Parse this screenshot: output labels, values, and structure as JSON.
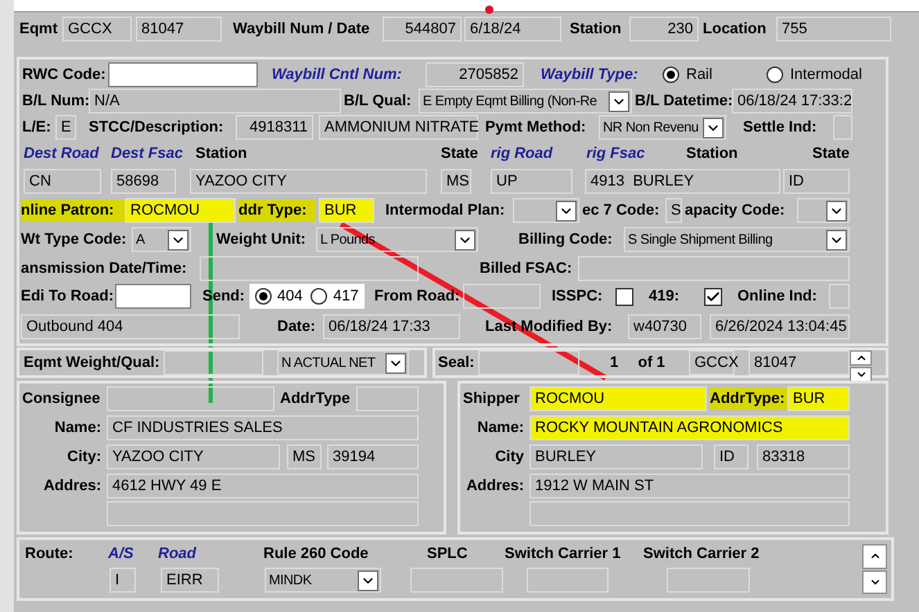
{
  "header": [
    {
      "kind": "label",
      "text": "Eqmt"
    },
    {
      "kind": "field",
      "value": "GCCX"
    },
    {
      "kind": "field",
      "value": "81047"
    },
    {
      "kind": "label",
      "text": "Waybill Num / Date"
    },
    {
      "kind": "field",
      "value": "544807"
    },
    {
      "kind": "field",
      "value": "6/18/24"
    },
    {
      "kind": "label",
      "text": "Station"
    },
    {
      "kind": "field",
      "value": "230"
    },
    {
      "kind": "label",
      "text": "Location"
    },
    {
      "kind": "field",
      "value": "755"
    }
  ],
  "waybill": [
    [
      {
        "kind": "label",
        "text": "RWC Code:"
      },
      {
        "kind": "input"
      },
      {
        "kind": "heading",
        "text": "Waybill Cntl Num:"
      },
      {
        "kind": "field",
        "value": "2705852"
      },
      {
        "kind": "heading",
        "text": "Waybill Type:"
      },
      {
        "kind": "radio",
        "label": "Rail",
        "selected": true
      },
      {
        "kind": "radio",
        "label": "Intermodal",
        "selected": false
      }
    ],
    [
      {
        "kind": "label",
        "text": "B/L Num:"
      },
      {
        "kind": "field",
        "value": "N/A"
      },
      {
        "kind": "label",
        "text": "B/L Qual:"
      },
      {
        "kind": "select",
        "value": "E Empty Eqmt Billing (Non-Re"
      },
      {
        "kind": "label",
        "text": "B/L Datetime:"
      },
      {
        "kind": "field",
        "value": "06/18/24 17:33:2"
      }
    ],
    [
      {
        "kind": "label",
        "text": "L/E:"
      },
      {
        "kind": "field",
        "value": "E"
      },
      {
        "kind": "label",
        "text": "STCC/Description:"
      },
      {
        "kind": "field",
        "value": "4918311"
      },
      {
        "kind": "field",
        "value": "AMMONIUM NITRATE"
      },
      {
        "kind": "label",
        "text": "Pymt Method:"
      },
      {
        "kind": "select",
        "value": "NR Non Revenu"
      },
      {
        "kind": "label",
        "text": "Settle Ind:"
      },
      {
        "kind": "field"
      }
    ],
    [
      {
        "kind": "heading",
        "text": "Dest Road"
      },
      {
        "kind": "heading",
        "text": "Dest Fsac"
      },
      {
        "kind": "label",
        "text": "Station"
      },
      {
        "kind": "label",
        "text": "State"
      },
      {
        "kind": "heading",
        "text": "rig Road"
      },
      {
        "kind": "heading",
        "text": "rig Fsac"
      },
      {
        "kind": "label",
        "text": "Station"
      },
      {
        "kind": "label",
        "text": "State"
      }
    ],
    [
      {
        "kind": "field",
        "value": "CN"
      },
      {
        "kind": "field",
        "value": "58698"
      },
      {
        "kind": "field",
        "value": "YAZOO CITY"
      },
      {
        "kind": "field",
        "value": "MS"
      },
      {
        "kind": "field",
        "value": "UP"
      },
      {
        "kind": "field",
        "value": "4913  BURLEY"
      },
      {
        "kind": "field",
        "value": "ID"
      }
    ],
    [
      {
        "kind": "label",
        "text": "nline Patron:",
        "highlighted": true
      },
      {
        "kind": "field",
        "value": "ROCMOU",
        "highlighted": true
      },
      {
        "kind": "label",
        "text": "ddr Type:",
        "highlighted": true
      },
      {
        "kind": "field",
        "value": "BUR",
        "highlighted": true
      },
      {
        "kind": "label",
        "text": "Intermodal Plan:"
      },
      {
        "kind": "select"
      },
      {
        "kind": "label",
        "text": "ec 7 Code:"
      },
      {
        "kind": "field",
        "value": "S"
      },
      {
        "kind": "label",
        "text": "apacity Code:"
      },
      {
        "kind": "select"
      }
    ],
    [
      {
        "kind": "label",
        "text": "Wt Type Code:"
      },
      {
        "kind": "select",
        "value": "A"
      },
      {
        "kind": "label",
        "text": "Weight Unit:"
      },
      {
        "kind": "select",
        "value": "L Pounds"
      },
      {
        "kind": "label",
        "text": "Billing Code:"
      },
      {
        "kind": "select",
        "value": "S Single Shipment Billing"
      }
    ],
    [
      {
        "kind": "label",
        "text": "ansmission Date/Time:"
      },
      {
        "kind": "field"
      },
      {
        "kind": "label",
        "text": "Billed FSAC:"
      },
      {
        "kind": "field"
      }
    ],
    [
      {
        "kind": "label",
        "text": "Edi To Road:"
      },
      {
        "kind": "input"
      },
      {
        "kind": "label",
        "text": "Send:"
      },
      {
        "kind": "radio-group",
        "options": [
          {
            "label": "404",
            "selected": true
          },
          {
            "label": "417",
            "selected": false
          }
        ]
      },
      {
        "kind": "label",
        "text": "From Road:"
      },
      {
        "kind": "field"
      },
      {
        "kind": "label",
        "text": "ISSPC:"
      },
      {
        "kind": "checkbox",
        "checked": false
      },
      {
        "kind": "label",
        "text": "419:"
      },
      {
        "kind": "checkbox",
        "checked": true
      },
      {
        "kind": "label",
        "text": "Online Ind:"
      },
      {
        "kind": "field"
      }
    ],
    [
      {
        "kind": "field",
        "value": "Outbound 404"
      },
      {
        "kind": "label",
        "text": "Date:"
      },
      {
        "kind": "field",
        "value": "06/18/24 17:33"
      },
      {
        "kind": "label",
        "text": "Last Modified By:"
      },
      {
        "kind": "field",
        "value": "w40730"
      },
      {
        "kind": "field",
        "value": "6/26/2024 13:04:45"
      }
    ]
  ],
  "weight": [
    {
      "kind": "label",
      "text": "Eqmt Weight/Qual:"
    },
    {
      "kind": "field"
    },
    {
      "kind": "select",
      "value": "N ACTUAL NET"
    }
  ],
  "seal": [
    {
      "kind": "label",
      "text": "Seal:"
    },
    {
      "kind": "field"
    },
    {
      "kind": "text",
      "text": "1"
    },
    {
      "kind": "text",
      "text": "of 1"
    },
    {
      "kind": "field",
      "value": "GCCX"
    },
    {
      "kind": "field",
      "value": "81047"
    }
  ],
  "consignee": [
    [
      {
        "kind": "label",
        "text": "Consignee"
      },
      {
        "kind": "field"
      },
      {
        "kind": "label",
        "text": "AddrType"
      },
      {
        "kind": "field"
      }
    ],
    [
      {
        "kind": "label",
        "text": "Name:"
      },
      {
        "kind": "field",
        "value": "CF INDUSTRIES SALES"
      }
    ],
    [
      {
        "kind": "label",
        "text": "City:"
      },
      {
        "kind": "field",
        "value": "YAZOO CITY"
      },
      {
        "kind": "field",
        "value": "MS"
      },
      {
        "kind": "field",
        "value": "39194"
      }
    ],
    [
      {
        "kind": "label",
        "text": "Addres:"
      },
      {
        "kind": "field",
        "value": "4612 HWY 49 E"
      }
    ],
    [
      {
        "kind": "field"
      }
    ]
  ],
  "shipper": [
    [
      {
        "kind": "label",
        "text": "Shipper"
      },
      {
        "kind": "field",
        "value": "ROCMOU",
        "highlighted": true
      },
      {
        "kind": "label",
        "text": "AddrType:",
        "highlighted": true
      },
      {
        "kind": "field",
        "value": "BUR",
        "highlighted": true
      }
    ],
    [
      {
        "kind": "label",
        "text": "Name:"
      },
      {
        "kind": "field",
        "value": "ROCKY MOUNTAIN AGRONOMICS",
        "highlighted": true
      }
    ],
    [
      {
        "kind": "label",
        "text": "City"
      },
      {
        "kind": "field",
        "value": "BURLEY"
      },
      {
        "kind": "field",
        "value": "ID"
      },
      {
        "kind": "field",
        "value": "83318"
      }
    ],
    [
      {
        "kind": "label",
        "text": "Addres:"
      },
      {
        "kind": "field",
        "value": "1912 W MAIN ST"
      }
    ],
    [
      {
        "kind": "field"
      }
    ]
  ],
  "route": [
    [
      {
        "kind": "label",
        "text": "Route:"
      },
      {
        "kind": "heading",
        "text": "A/S"
      },
      {
        "kind": "heading",
        "text": "Road"
      },
      {
        "kind": "label",
        "text": "Rule 260 Code"
      },
      {
        "kind": "label",
        "text": "SPLC"
      },
      {
        "kind": "label",
        "text": "Switch Carrier 1"
      },
      {
        "kind": "label",
        "text": "Switch Carrier 2"
      }
    ],
    [
      {
        "kind": "field",
        "value": "I"
      },
      {
        "kind": "field",
        "value": "EIRR"
      },
      {
        "kind": "select",
        "value": "MINDK"
      },
      {
        "kind": "field"
      },
      {
        "kind": "field"
      },
      {
        "kind": "field"
      }
    ]
  ]
}
